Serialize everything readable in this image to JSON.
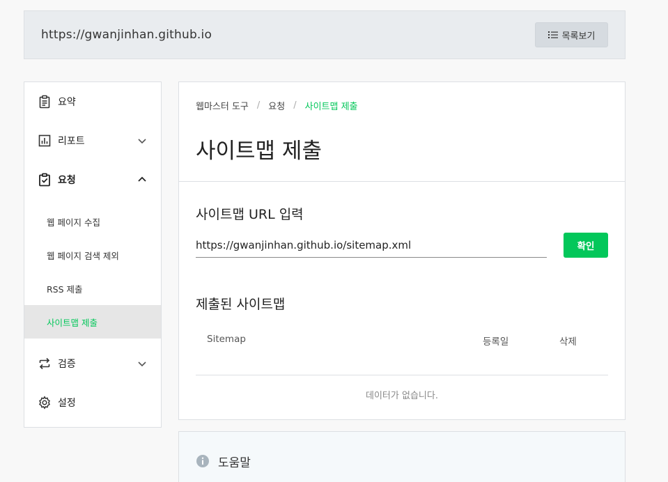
{
  "site": {
    "url": "https://gwanjinhan.github.io",
    "list_button_label": "목록보기"
  },
  "sidebar": {
    "items": [
      {
        "label": "요약",
        "icon": "clipboard-icon"
      },
      {
        "label": "리포트",
        "icon": "bar-chart-icon"
      },
      {
        "label": "요청",
        "icon": "clipboard-check-icon"
      },
      {
        "label": "검증",
        "icon": "repeat-icon"
      },
      {
        "label": "설정",
        "icon": "gear-icon"
      }
    ],
    "sub_items": [
      {
        "label": "웹 페이지 수집"
      },
      {
        "label": "웹 페이지 검색 제외"
      },
      {
        "label": "RSS 제출"
      },
      {
        "label": "사이트맵 제출"
      }
    ]
  },
  "breadcrumb": {
    "items": [
      "웹마스터 도구",
      "요청",
      "사이트맵 제출"
    ],
    "separator": "/"
  },
  "page": {
    "title": "사이트맵 제출"
  },
  "sitemap_form": {
    "section_title": "사이트맵 URL 입력",
    "input_value": "https://gwanjinhan.github.io/sitemap.xml",
    "confirm_label": "확인"
  },
  "submitted": {
    "section_title": "제출된 사이트맵",
    "columns": [
      "Sitemap",
      "등록일",
      "삭제"
    ],
    "empty_text": "데이터가 없습니다."
  },
  "help": {
    "title": "도움말"
  },
  "colors": {
    "accent": "#03c75a",
    "background": "#f8f8f8",
    "bar_background": "#e9ecef"
  }
}
